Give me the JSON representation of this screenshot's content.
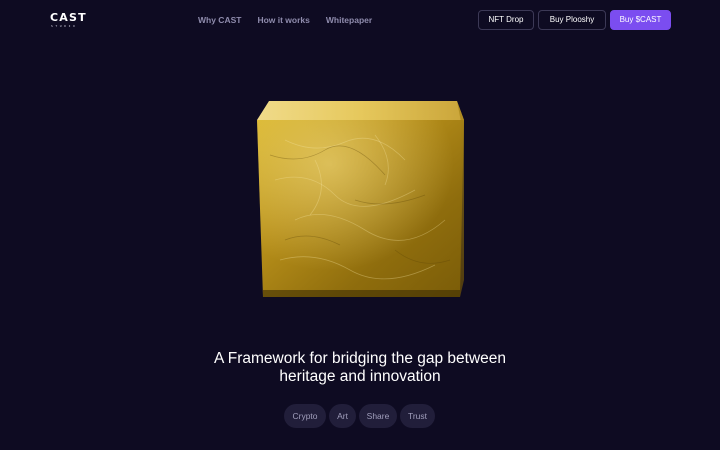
{
  "brand": {
    "logo_text": "CAST",
    "logo_subtext": "STUDIO"
  },
  "nav": {
    "items": [
      {
        "label": "Why CAST"
      },
      {
        "label": "How it works"
      },
      {
        "label": "Whitepaper"
      }
    ]
  },
  "actions": {
    "nft_drop": "NFT Drop",
    "buy_plooshy": "Buy Plooshy",
    "buy_cast": "Buy $CAST"
  },
  "hero": {
    "image_icon": "gold-cube-icon",
    "headline_line1": "A Framework for bridging the gap between",
    "headline_line2": "heritage and innovation"
  },
  "tags": [
    {
      "label": "Crypto"
    },
    {
      "label": "Art"
    },
    {
      "label": "Share"
    },
    {
      "label": "Trust"
    }
  ],
  "colors": {
    "background": "#0e0b22",
    "accent": "#7b4df0",
    "tag_bg": "#211e3a",
    "nav_text": "#8f8cad",
    "gold": "#c9a21c"
  }
}
